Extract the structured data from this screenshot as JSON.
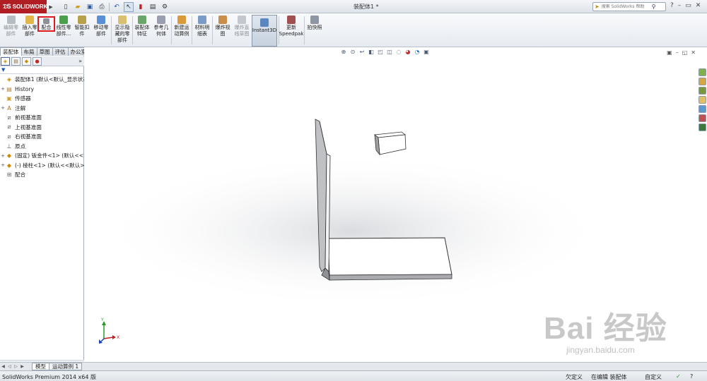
{
  "app": {
    "logo_text": "SOLIDWORKS",
    "document_title": "装配体1 *"
  },
  "search": {
    "placeholder": "搜索 SolidWorks 帮助"
  },
  "toolbar": {
    "tools": [
      {
        "label": "编辑零\n部件",
        "state": "disabled",
        "icon": "edit-component-icon"
      },
      {
        "label": "插入零\n部件",
        "state": "normal",
        "icon": "insert-component-icon"
      },
      {
        "label": "配合",
        "state": "highlighted",
        "icon": "mate-icon"
      },
      {
        "label": "线性零\n部件...",
        "state": "normal",
        "icon": "linear-pattern-icon"
      },
      {
        "label": "智能扣\n件",
        "state": "normal",
        "icon": "smart-fasteners-icon"
      },
      {
        "label": "移动零\n部件",
        "state": "normal",
        "icon": "move-component-icon"
      },
      {
        "label": "显示隐\n藏的零\n部件",
        "state": "normal",
        "icon": "show-hidden-icon"
      },
      {
        "label": "装配体\n特征",
        "state": "normal",
        "icon": "assembly-features-icon"
      },
      {
        "label": "参考几\n何体",
        "state": "normal",
        "icon": "reference-geometry-icon"
      },
      {
        "label": "新建运\n动算例",
        "state": "normal",
        "icon": "new-motion-study-icon"
      },
      {
        "label": "材料明\n细表",
        "state": "normal",
        "icon": "bill-of-materials-icon"
      },
      {
        "label": "爆炸视\n图",
        "state": "normal",
        "icon": "exploded-view-icon"
      },
      {
        "label": "爆炸直\n线草图",
        "state": "disabled",
        "icon": "explode-line-sketch-icon"
      },
      {
        "label": "Instant3D",
        "state": "active",
        "icon": "instant3d-icon"
      },
      {
        "label": "更新\nSpeedpak",
        "state": "normal",
        "icon": "update-speedpak-icon"
      },
      {
        "label": "拍快照",
        "state": "normal",
        "icon": "snapshot-icon"
      }
    ]
  },
  "left_tabs": [
    "装配体",
    "布局",
    "草图",
    "评估",
    "办公室产品"
  ],
  "tree": {
    "nodes": [
      {
        "label": "装配体1  (默认<默认_显示状态",
        "icon": "assembly-icon",
        "expand": ""
      },
      {
        "label": "History",
        "icon": "history-icon",
        "expand": "+"
      },
      {
        "label": "传感器",
        "icon": "sensors-icon",
        "expand": ""
      },
      {
        "label": "注解",
        "icon": "annotations-icon",
        "expand": "+"
      },
      {
        "label": "前视基准面",
        "icon": "plane-icon",
        "expand": ""
      },
      {
        "label": "上视基准面",
        "icon": "plane-icon",
        "expand": ""
      },
      {
        "label": "右视基准面",
        "icon": "plane-icon",
        "expand": ""
      },
      {
        "label": "原点",
        "icon": "origin-icon",
        "expand": ""
      },
      {
        "label": "(固定) 钣金件<1> (默认<<",
        "icon": "part-icon",
        "expand": "+"
      },
      {
        "label": "(-) 棱柱<1> (默认<<默认>",
        "icon": "part-icon",
        "expand": "+"
      },
      {
        "label": "配合",
        "icon": "mates-folder-icon",
        "expand": ""
      }
    ]
  },
  "model_tabs": [
    "模型",
    "运动算例 1"
  ],
  "status": {
    "product": "SolidWorks Premium 2014 x64 版",
    "definition": "欠定义",
    "mode": "在编辑 装配体",
    "units": "自定义"
  },
  "watermark": {
    "main": "Bai 经验",
    "sub": "jingyan.baidu.com"
  }
}
